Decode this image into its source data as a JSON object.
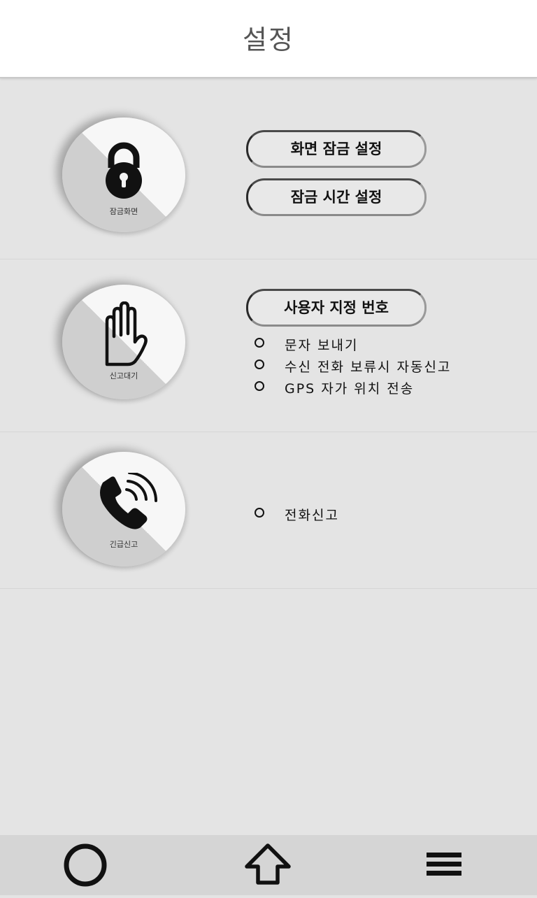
{
  "header": {
    "title": "설정"
  },
  "lock_section": {
    "disc_label": "잠금화면",
    "icon": "padlock-icon",
    "buttons": [
      {
        "label": "화면 잠금 설정"
      },
      {
        "label": "잠금 시간 설정"
      }
    ]
  },
  "standby_section": {
    "disc_label": "신고대기",
    "icon": "hand-icon",
    "button": {
      "label": "사용자 지정 번호"
    },
    "options": [
      {
        "label": "문자 보내기"
      },
      {
        "label": "수신 전화 보류시 자동신고"
      },
      {
        "label": "GPS 자가 위치 전송"
      }
    ]
  },
  "emergency_section": {
    "disc_label": "긴급신고",
    "icon": "phone-ringing-icon",
    "options": [
      {
        "label": "전화신고"
      }
    ]
  },
  "nav": {
    "back_icon": "circle-icon",
    "home_icon": "up-arrow-icon",
    "menu_icon": "menu-icon"
  }
}
